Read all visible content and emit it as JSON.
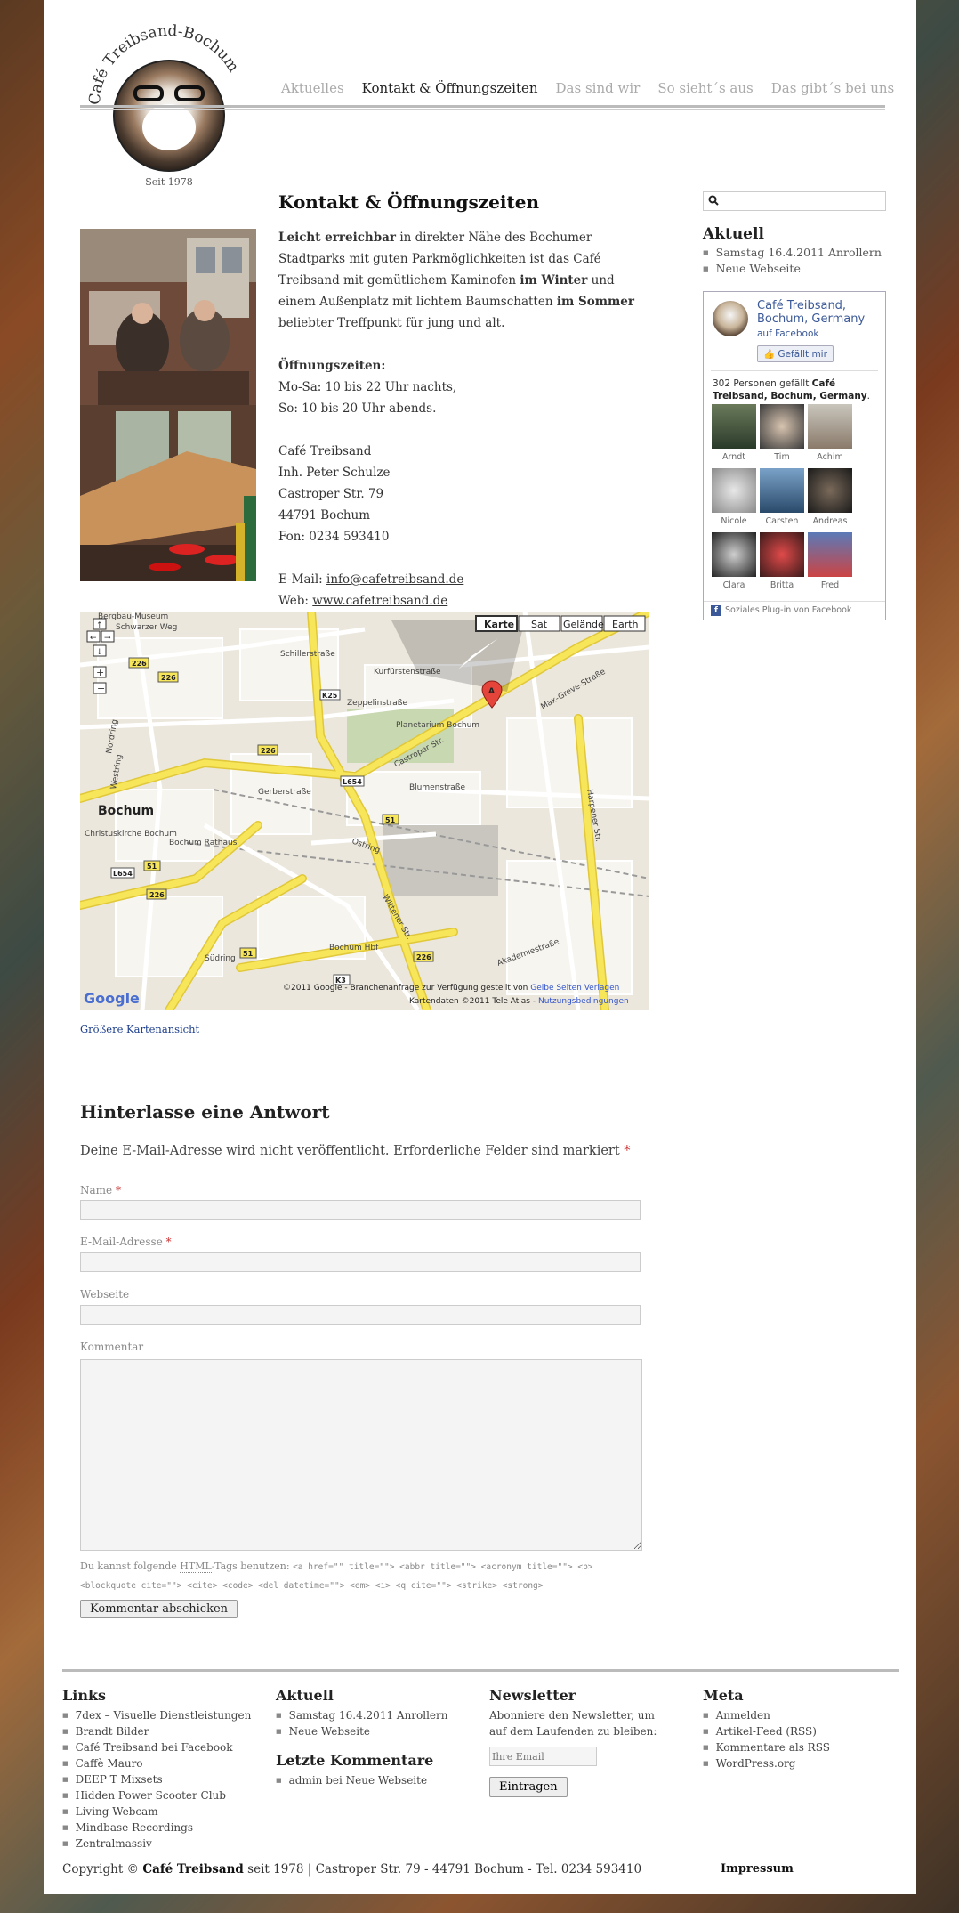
{
  "site": {
    "logo_text": "Café Treibsand-Bochum",
    "logo_since": "Seit 1978"
  },
  "nav": [
    {
      "label": "Aktuelles",
      "active": false
    },
    {
      "label": "Kontakt & Öffnungszeiten",
      "active": true
    },
    {
      "label": "Das sind wir",
      "active": false
    },
    {
      "label": "So sieht´s aus",
      "active": false
    },
    {
      "label": "Das gibt´s bei uns",
      "active": false
    }
  ],
  "content": {
    "title": "Kontakt & Öffnungszeiten",
    "intro": {
      "b1": "Leicht erreichbar",
      "t1": " in direkter Nähe des Bochumer Stadtparks mit guten Parkmöglichkeiten ist das Café Treibsand mit gemütlichem Kaminofen ",
      "b2": "im Winter",
      "t2": " und einem Außenplatz mit lichtem Baumschatten ",
      "b3": "im Sommer",
      "t3": " beliebter Treffpunkt für jung und alt."
    },
    "hours_label": "Öffnungszeiten:",
    "hours_1": "Mo-Sa: 10 bis 22 Uhr nachts,",
    "hours_2": "So: 10 bis 20 Uhr abends.",
    "address": [
      "Café Treibsand",
      "Inh. Peter Schulze",
      "Castroper Str. 79",
      "44791 Bochum",
      "Fon: 0234 593410"
    ],
    "email_label": "E-Mail: ",
    "email": "info@cafetreibsand.de",
    "web_label": "Web: ",
    "web": "www.cafetreibsand.de",
    "map_link": "Größere Kartenansicht"
  },
  "map": {
    "tabs": [
      "Karte",
      "Sat",
      "Gelände",
      "Earth"
    ],
    "active_tab": "Karte",
    "labels": {
      "bochum": "Bochum",
      "castroper": "Castroper Str.",
      "planetarium": "Planetarium Bochum",
      "kurfuersten": "Kurfürstenstraße",
      "zeppelin": "Zeppelinstraße",
      "blumen": "Blumenstraße",
      "ostring": "Ostring",
      "wittener": "Wittener Str.",
      "hbf": "Bochum Hbf",
      "suedring": "Südring",
      "akademie": "Akademiestraße",
      "schiller": "Schillerstraße",
      "max_greve": "Max-Greve-Straße",
      "gerberstr": "Gerberstraße",
      "harpener": "Harpener Str.",
      "rathaus": "Bochum Rathaus",
      "christus": "Christuskirche Bochum",
      "bergbau": "Bergbau-Museum",
      "schwarzer_weg": "Schwarzer Weg",
      "nordring": "Nordring",
      "westring": "Westring"
    },
    "shields": [
      "226",
      "K25",
      "226",
      "L654",
      "51",
      "51",
      "226",
      "L654",
      "226",
      "51",
      "226",
      "K3"
    ],
    "marker": "A",
    "copyright_1": "©2011 Google - Branchenanfrage zur Verfügung gestellt von ",
    "copyright_1_link": "Gelbe Seiten Verlagen",
    "copyright_2": "Kartendaten ©2011 Tele Atlas - ",
    "copyright_2_link": "Nutzungsbedingungen",
    "google": "Google"
  },
  "reply": {
    "title": "Hinterlasse eine Antwort",
    "note": "Deine E-Mail-Adresse wird nicht veröffentlicht. Erforderliche Felder sind markiert ",
    "req_mark": "*",
    "name_label": "Name",
    "email_label": "E-Mail-Adresse",
    "website_label": "Webseite",
    "comment_label": "Kommentar",
    "tags_prefix": "Du kannst folgende ",
    "tags_html": "HTML",
    "tags_mid": "-Tags benutzen: ",
    "tags_code": "<a href=\"\" title=\"\"> <abbr title=\"\"> <acronym title=\"\"> <b> <blockquote cite=\"\"> <cite> <code> <del datetime=\"\"> <em> <i> <q cite=\"\"> <strike> <strong>",
    "submit": "Kommentar abschicken"
  },
  "sidebar": {
    "aktuell_title": "Aktuell",
    "aktuell": [
      "Samstag 16.4.2011 Anrollern",
      "Neue Webseite"
    ],
    "fb": {
      "name": "Café Treibsand, Bochum, Germany",
      "sub": "auf Facebook",
      "like": "Gefällt mir",
      "count_pre": "302 Personen gefällt ",
      "count_name": "Café Treibsand, Bochum, Germany",
      "count_post": ".",
      "fans": [
        "Arndt",
        "Tim",
        "Achim",
        "Nicole",
        "Carsten",
        "Andreas",
        "Clara",
        "Britta",
        "Fred"
      ],
      "footer": "Soziales Plug-in von Facebook"
    }
  },
  "footer": {
    "links_title": "Links",
    "links": [
      "7dex – Visuelle Dienstleistungen",
      "Brandt Bilder",
      "Café Treibsand bei Facebook",
      "Caffè Mauro",
      "DEEP T Mixsets",
      "Hidden Power Scooter Club",
      "Living Webcam",
      "Mindbase Recordings",
      "Zentralmassiv"
    ],
    "aktuell_title": "Aktuell",
    "aktuell": [
      "Samstag 16.4.2011 Anrollern",
      "Neue Webseite"
    ],
    "comments_title": "Letzte Kommentare",
    "comments": [
      "admin bei Neue Webseite"
    ],
    "newsletter_title": "Newsletter",
    "newsletter_text": "Abonniere den Newsletter, um auf dem Laufenden zu bleiben:",
    "newsletter_placeholder": "Ihre Email",
    "newsletter_button": "Eintragen",
    "meta_title": "Meta",
    "meta": [
      "Anmelden",
      "Artikel-Feed (RSS)",
      "Kommentare als RSS",
      "WordPress.org"
    ],
    "copyright_pre": "Copyright © ",
    "copyright_name": "Café Treibsand",
    "copyright_post": " seit 1978 | Castroper Str. 79 - 44791 Bochum - Tel. 0234 593410",
    "impressum": "Impressum"
  },
  "colors": {
    "accent_fb": "#3b5998",
    "link": "#1a3c8c",
    "required": "#cc3333",
    "map_road": "#f7e55a"
  }
}
